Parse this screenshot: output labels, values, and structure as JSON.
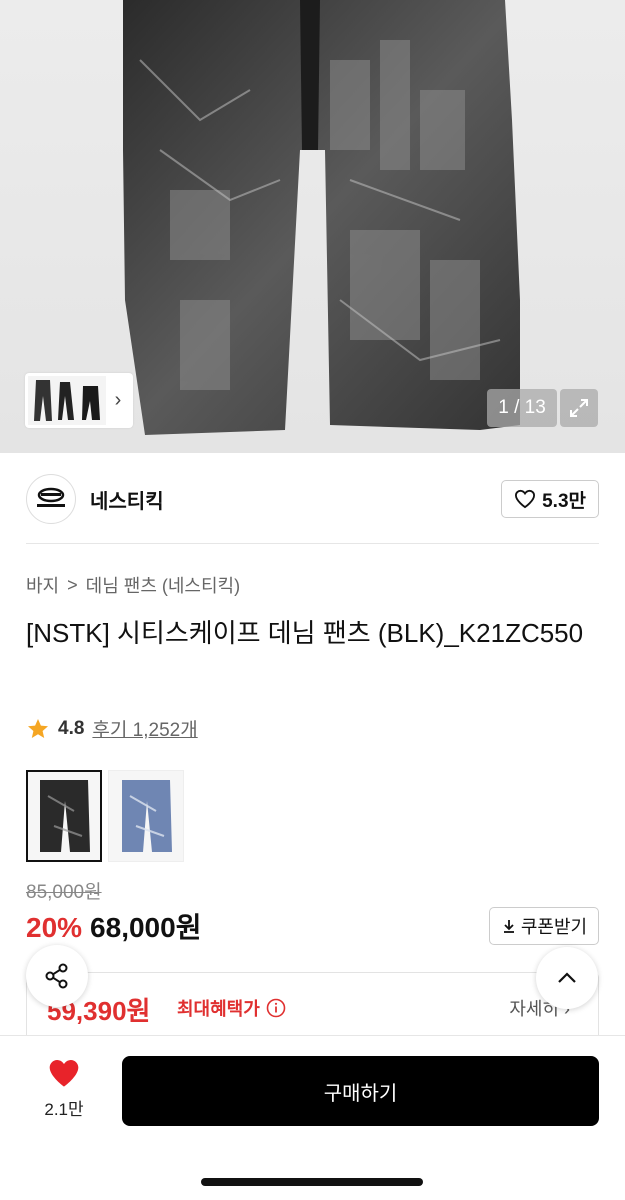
{
  "gallery": {
    "counter": "1 / 13",
    "thumb_next": "›"
  },
  "brand": {
    "name": "네스티킥",
    "likes": "5.3만"
  },
  "breadcrumb": {
    "category": "바지",
    "separator": ">",
    "subcategory": "데님 팬츠 (네스티킥)"
  },
  "product": {
    "title": "[NSTK] 시티스케이프 데님 팬츠 (BLK)_K21ZC550",
    "rating": "4.8",
    "reviews": "후기 1,252개",
    "original_price": "85,000원",
    "discount": "20%",
    "price": "68,000원",
    "coupon_label": "쿠폰받기"
  },
  "benefit": {
    "price": "59,390원",
    "label": "최대혜택가",
    "more": "자세히 ›"
  },
  "bottom": {
    "wish_count": "2.1만",
    "buy_label": "구매하기"
  },
  "colors": {
    "accent": "#e03030",
    "star": "#f5a623",
    "heart": "#e8232a"
  }
}
